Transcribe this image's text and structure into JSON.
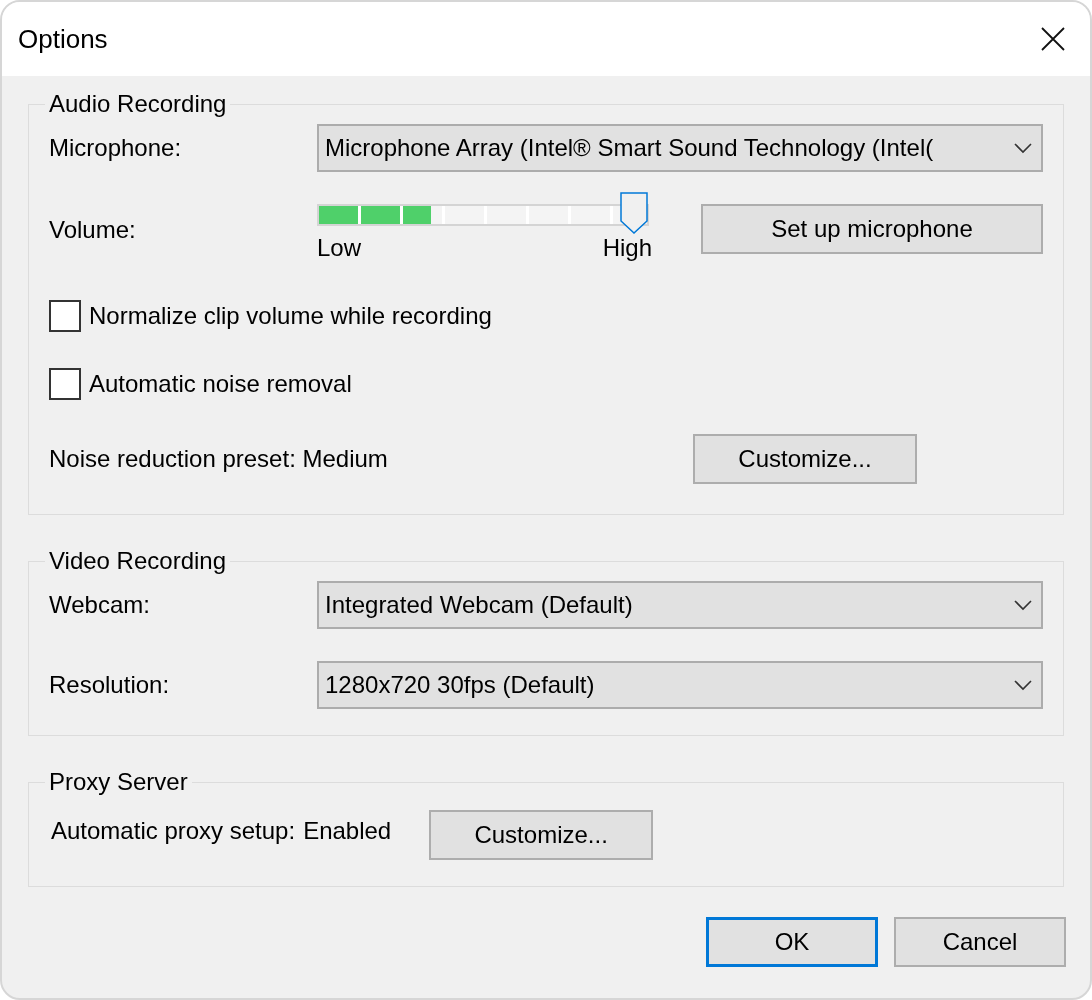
{
  "window": {
    "title": "Options"
  },
  "audio": {
    "legend": "Audio Recording",
    "microphone": {
      "label": "Microphone:",
      "value": "Microphone Array (Intel® Smart Sound Technology (Intel("
    },
    "volume": {
      "label": "Volume:",
      "meter": {
        "level": 0.34
      },
      "slider": {
        "level": 0.96
      },
      "low_label": "Low",
      "high_label": "High"
    },
    "setup_button": "Set up microphone",
    "checkboxes": [
      {
        "label": "Normalize clip volume while recording",
        "checked": false
      },
      {
        "label": "Automatic noise removal",
        "checked": false
      }
    ],
    "noise_preset": {
      "text": "Noise reduction preset: Medium",
      "button": "Customize..."
    }
  },
  "video": {
    "legend": "Video Recording",
    "fields": [
      {
        "label": "Webcam:",
        "value": "Integrated Webcam (Default)"
      },
      {
        "label": "Resolution:",
        "value": "1280x720 30fps (Default)"
      }
    ]
  },
  "proxy": {
    "legend": "Proxy Server",
    "label": "Automatic proxy setup:",
    "value": "Enabled",
    "button": "Customize..."
  },
  "buttons": [
    {
      "label": "OK",
      "default": true
    },
    {
      "label": "Cancel",
      "default": false
    }
  ]
}
